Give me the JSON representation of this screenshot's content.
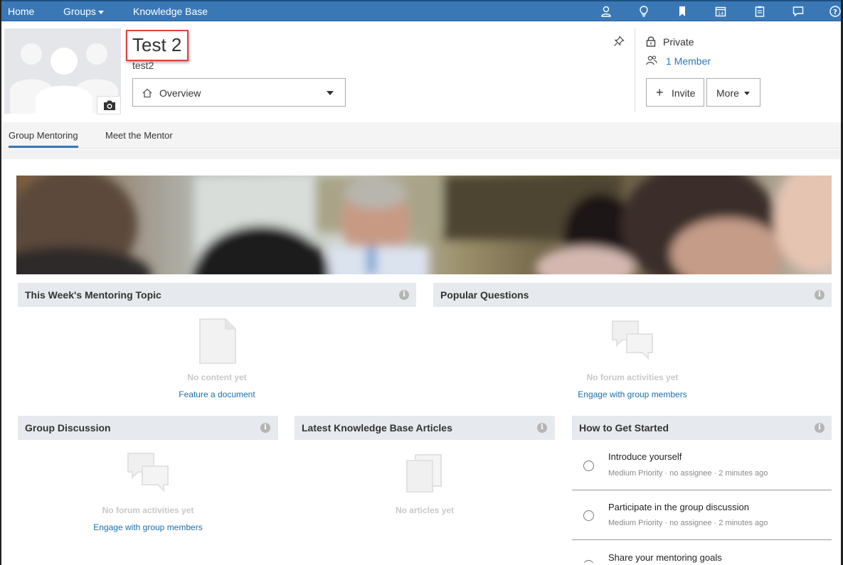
{
  "nav": {
    "home": "Home",
    "groups": "Groups",
    "knowledge_base": "Knowledge Base",
    "icons": [
      "person-icon",
      "lightbulb-icon",
      "bookmark-icon",
      "calendar-icon",
      "clipboard-icon",
      "chat-icon",
      "help-icon"
    ],
    "calendar_day": "14",
    "help_glyph": "?",
    "bar_color": "#3a78b5"
  },
  "group": {
    "title": "Test 2",
    "handle": "test2",
    "view_select": "Overview",
    "privacy": "Private",
    "members": "1 Member",
    "invite_label": "Invite",
    "more_label": "More"
  },
  "tabs": [
    {
      "label": "Group Mentoring",
      "active": true
    },
    {
      "label": "Meet the Mentor",
      "active": false
    }
  ],
  "widgets": {
    "mentoring_topic": {
      "title": "This Week's Mentoring Topic",
      "empty_text": "No content yet",
      "action": "Feature a document"
    },
    "popular_questions": {
      "title": "Popular Questions",
      "empty_text": "No forum activities yet",
      "action": "Engage with group members"
    },
    "group_discussion": {
      "title": "Group Discussion",
      "empty_text": "No forum activities yet",
      "action": "Engage with group members"
    },
    "kb_articles": {
      "title": "Latest Knowledge Base Articles",
      "empty_text": "No articles yet"
    },
    "get_started": {
      "title": "How to Get Started",
      "tasks": [
        {
          "title": "Introduce yourself",
          "meta": "Medium Priority · no assignee · 2 minutes ago"
        },
        {
          "title": "Participate in the group discussion",
          "meta": "Medium Priority · no assignee · 2 minutes ago"
        },
        {
          "title": "Share your mentoring goals",
          "meta": ""
        }
      ]
    }
  },
  "info_glyph": "i",
  "colors": {
    "accent": "#3a78b5",
    "link": "#1d6fa8",
    "highlight_box": "#e04040"
  }
}
